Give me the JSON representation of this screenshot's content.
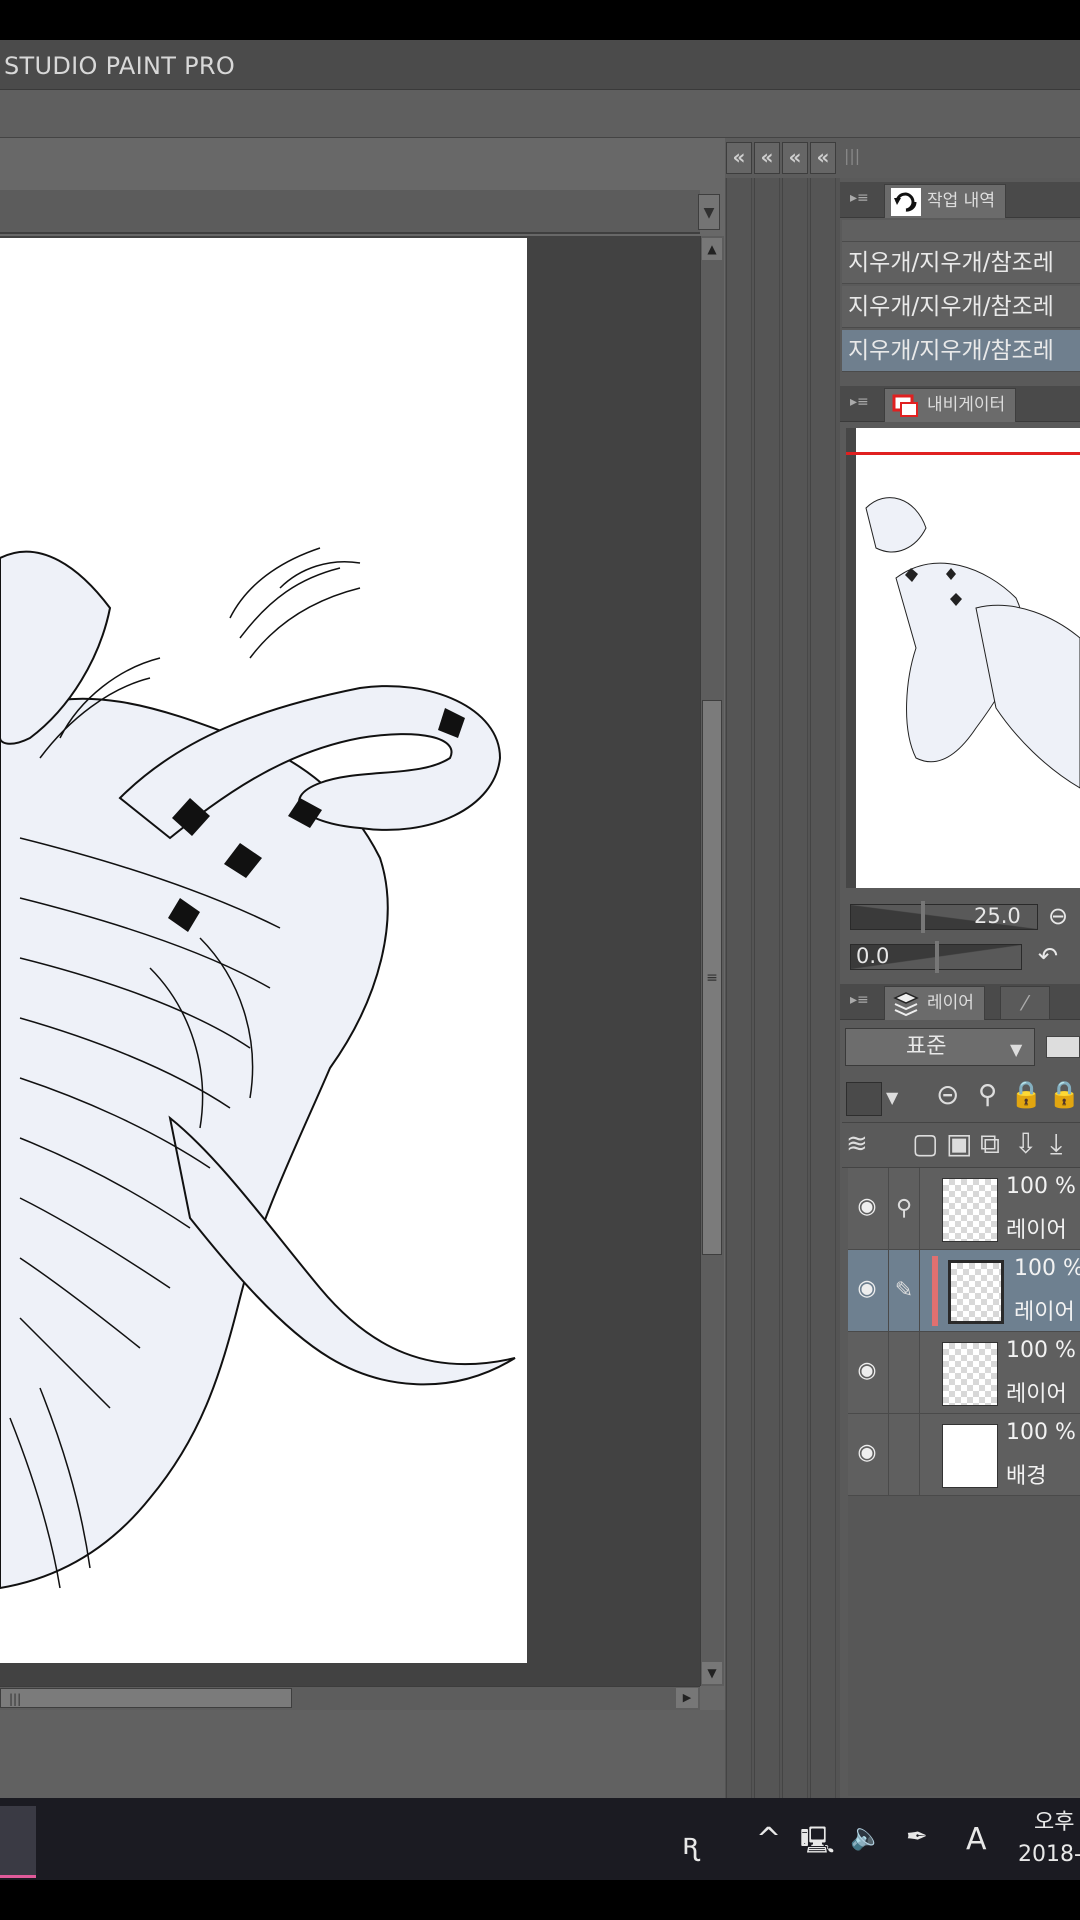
{
  "app": {
    "title": "STUDIO PAINT PRO"
  },
  "history_panel": {
    "tab_label": "작업 내역",
    "items": [
      {
        "label": "지우개/지우개/참조레",
        "selected": false
      },
      {
        "label": "지우개/지우개/참조레",
        "selected": false
      },
      {
        "label": "지우개/지우개/참조레",
        "selected": true
      }
    ]
  },
  "navigator_panel": {
    "tab_label": "내비게이터",
    "zoom_value": "25.0",
    "rotation_value": "0.0"
  },
  "layer_panel": {
    "tab_label": "레이어",
    "blend_mode": "표준",
    "layers": [
      {
        "opacity": "100 %",
        "name": "레이어",
        "selected": false,
        "thumb": "sketch"
      },
      {
        "opacity": "100 %",
        "name": "레이어",
        "selected": true,
        "thumb": "transparent"
      },
      {
        "opacity": "100 %",
        "name": "레이어",
        "selected": false,
        "thumb": "faint"
      },
      {
        "opacity": "100 %",
        "name": "배경",
        "selected": false,
        "thumb": "white"
      }
    ]
  },
  "taskbar": {
    "input_indicator": "A",
    "clock_time": "오후",
    "clock_date": "2018-"
  },
  "colors": {
    "accent_red": "#e02020",
    "selected_row": "#6f7f8e",
    "panel_bg": "#5a5a5a"
  }
}
